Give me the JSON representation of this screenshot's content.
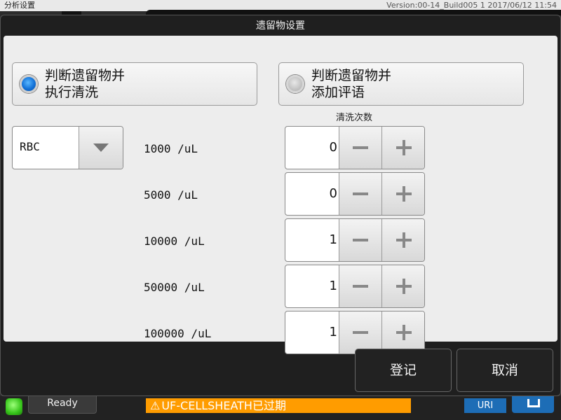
{
  "topbar": {
    "title": "分析设置",
    "version": "Version:00-14_Build005 1 2017/06/12 11:54"
  },
  "dialog": {
    "title": "遗留物设置",
    "options": [
      {
        "line1": "判断遗留物并",
        "line2": "执行清洗",
        "selected": true
      },
      {
        "line1": "判断遗留物并",
        "line2": "添加评语",
        "selected": false
      }
    ],
    "wash_header": "清洗次数",
    "dropdown": {
      "value": "RBC"
    },
    "rows": [
      {
        "label": "1000 /uL",
        "count": "0"
      },
      {
        "label": "5000 /uL",
        "count": "0"
      },
      {
        "label": "10000 /uL",
        "count": "1"
      },
      {
        "label": "50000 /uL",
        "count": "1"
      },
      {
        "label": "100000 /uL",
        "count": "1"
      }
    ],
    "buttons": {
      "ok": "登记",
      "cancel": "取消"
    }
  },
  "statusbar": {
    "ready": "Ready",
    "warning": "UF-CELLSHEATH已过期",
    "uri": "URI"
  },
  "icons": {
    "radio_selected": "radio-selected-icon",
    "radio_unselected": "radio-unselected-icon",
    "dropdown": "chevron-down-icon",
    "minus": "minus-icon",
    "plus": "plus-icon",
    "warning": "warning-icon"
  },
  "colors": {
    "accent_blue": "#1372d8",
    "warning_orange": "#ff9c00",
    "status_green": "#36c41a"
  }
}
